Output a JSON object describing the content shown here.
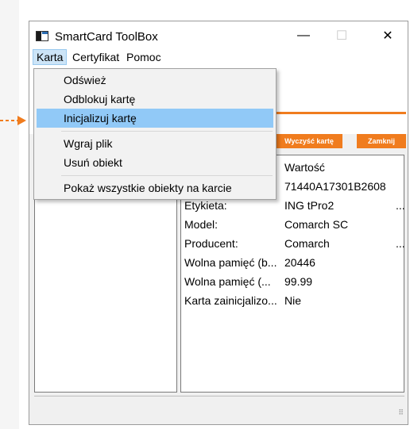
{
  "window": {
    "title": "SmartCard ToolBox",
    "controls": {
      "minimize": "—",
      "maximize": "☐",
      "close": "✕"
    }
  },
  "menubar": {
    "items": [
      {
        "label": "Karta",
        "active": true
      },
      {
        "label": "Certyfikat",
        "active": false
      },
      {
        "label": "Pomoc",
        "active": false
      }
    ]
  },
  "dropdown": {
    "items": [
      {
        "label": "Odśwież",
        "highlighted": false
      },
      {
        "label": "Odblokuj kartę",
        "highlighted": false
      },
      {
        "label": "Inicjalizuj kartę",
        "highlighted": true
      },
      {
        "label": "Wgraj plik",
        "highlighted": false
      },
      {
        "label": "Usuń obiekt",
        "highlighted": false
      },
      {
        "label": "Pokaż wszystkie obiekty na karcie",
        "highlighted": false
      }
    ]
  },
  "toolbar": {
    "wipe_label": "Wyczyść kartę",
    "close_label": "Zamknij"
  },
  "properties": {
    "header_value": "Wartość",
    "rows": [
      {
        "key": "",
        "value": "71440A17301B2608",
        "extra": ""
      },
      {
        "key": "Etykieta:",
        "value": "ING tPro2",
        "extra": "..."
      },
      {
        "key": "Model:",
        "value": "Comarch SC",
        "extra": ""
      },
      {
        "key": "Producent:",
        "value": "Comarch",
        "extra": "..."
      },
      {
        "key": "Wolna pamięć (b...",
        "value": "20446",
        "extra": ""
      },
      {
        "key": "Wolna pamięć (...",
        "value": "99.99",
        "extra": ""
      },
      {
        "key": "Karta zainicjalizo...",
        "value": "Nie",
        "extra": ""
      }
    ]
  },
  "colors": {
    "accent": "#f07c1e",
    "menu_highlight": "#91c9f7",
    "pointer_arrow": "#f07c1e"
  },
  "icons": {
    "pointer": "arrow-right-icon",
    "app": "smartcard-app-icon",
    "resize": "resize-grip-icon"
  }
}
